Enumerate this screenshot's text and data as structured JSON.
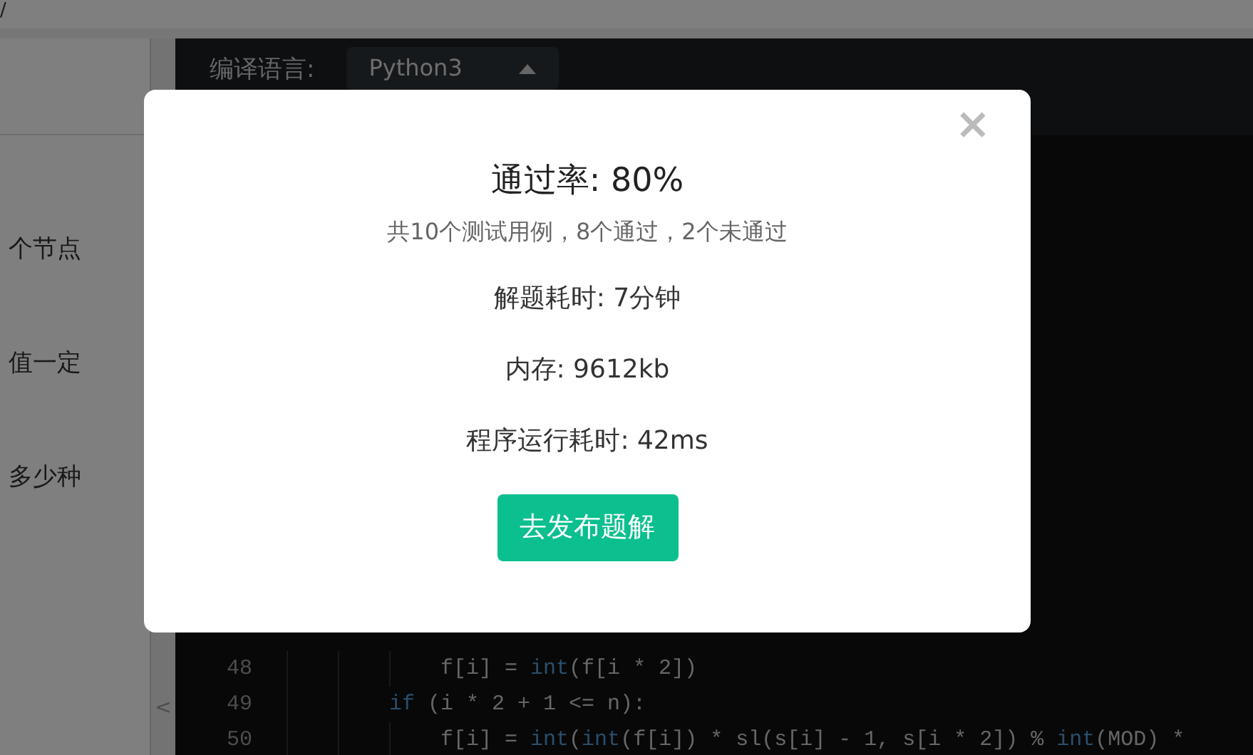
{
  "address_bar": {
    "text": "/"
  },
  "problem_panel": {
    "lines": [
      "个节点",
      "值一定",
      "多少种"
    ],
    "collapse_arrow": "<"
  },
  "editor": {
    "language_label": "编译语言:",
    "language_select": "Python3",
    "code_lines": [
      {
        "number": "48",
        "guides": [
          {
            "kind": "indent"
          },
          {
            "kind": "indent"
          },
          {
            "kind": "indent"
          }
        ],
        "tokens": [
          {
            "text": "f[i] = ",
            "kind": "plain"
          },
          {
            "text": "int",
            "kind": "builtin"
          },
          {
            "text": "(f[i * 2])",
            "kind": "plain"
          }
        ]
      },
      {
        "number": "49",
        "guides": [
          {
            "kind": "indent"
          },
          {
            "kind": "indent"
          }
        ],
        "tokens": [
          {
            "text": "if",
            "kind": "keyword"
          },
          {
            "text": " (i * 2 + 1 <= n):",
            "kind": "plain"
          }
        ]
      },
      {
        "number": "50",
        "guides": [
          {
            "kind": "indent"
          },
          {
            "kind": "indent"
          },
          {
            "kind": "indent"
          }
        ],
        "tokens": [
          {
            "text": "f[i] = ",
            "kind": "plain"
          },
          {
            "text": "int",
            "kind": "builtin"
          },
          {
            "text": "(",
            "kind": "plain"
          },
          {
            "text": "int",
            "kind": "builtin"
          },
          {
            "text": "(f[i]) * sl(s[i] - 1, s[i * 2]) % ",
            "kind": "plain"
          },
          {
            "text": "int",
            "kind": "builtin"
          },
          {
            "text": "(MOD) *",
            "kind": "plain"
          }
        ]
      }
    ]
  },
  "result_dialog": {
    "close": "×",
    "title": "通过率: 80%",
    "summary": "共10个测试用例，8个通过，2个未通过",
    "stats": [
      "解题耗时: 7分钟",
      "内存: 9612kb",
      "程序运行耗时: 42ms"
    ],
    "button": "去发布题解"
  }
}
